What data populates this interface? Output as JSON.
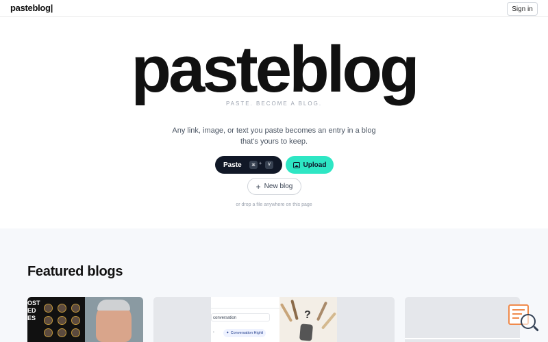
{
  "header": {
    "logo": "pasteblog|",
    "signin_label": "Sign in"
  },
  "hero": {
    "title": "pasteblog",
    "tagline": "PASTE. BECOME A BLOG.",
    "description": "Any link, image, or text you paste becomes an entry in a blog that's yours to keep.",
    "paste_label": "Paste",
    "paste_key1": "⌘",
    "paste_plus": "+",
    "paste_key2": "V",
    "upload_label": "Upload",
    "new_blog_label": "New blog",
    "drop_hint": "or drop a file anywhere on this page"
  },
  "featured": {
    "title": "Featured blogs",
    "card1_text": "OST\nED\nES",
    "card2_conversation": "conversation",
    "card2_chip": "Conversation Highli",
    "card2_question": "?"
  },
  "colors": {
    "accent": "#2ee6c4",
    "dark_button": "#111827",
    "widget_orange": "#f08a4b"
  },
  "icons": {
    "upload": "image-icon",
    "new_blog": "plus-icon",
    "widget": "search-document-icon"
  }
}
